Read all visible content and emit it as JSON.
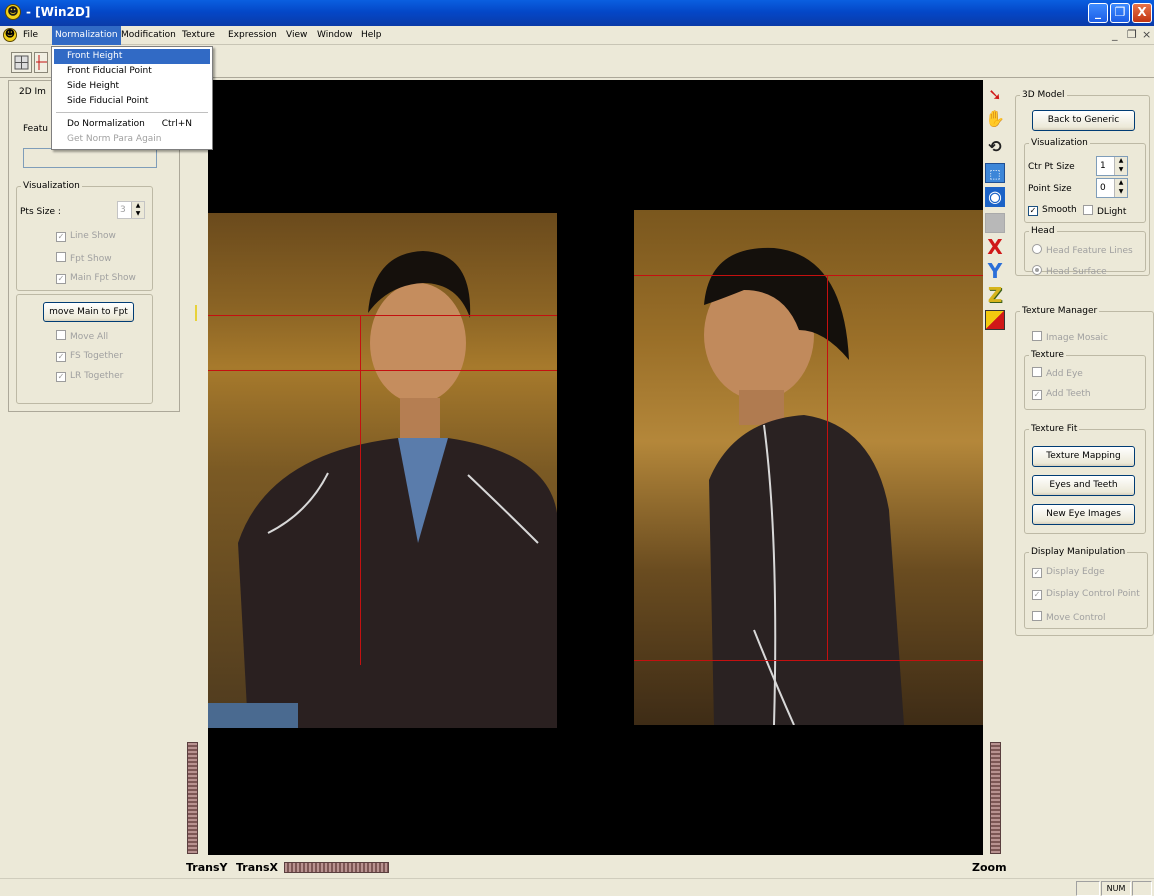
{
  "window": {
    "title": " - [Win2D]",
    "app_icon_glyph": "☻",
    "buttons": {
      "minimize": "_",
      "maximize": "❐",
      "close": "X"
    }
  },
  "menubar": {
    "items": [
      "File",
      "Normalization",
      "Modification",
      "Texture",
      "Expression",
      "View",
      "Window",
      "Help"
    ],
    "active": "Normalization",
    "mdi_buttons": {
      "minimize": "_",
      "restore": "❐",
      "close": "×"
    }
  },
  "normalization_menu": {
    "items": [
      {
        "label": "Front Height",
        "shortcut": "",
        "highlighted": true,
        "disabled": false
      },
      {
        "label": "Front Fiducial Point",
        "shortcut": "",
        "highlighted": false,
        "disabled": false
      },
      {
        "label": "Side Height",
        "shortcut": "",
        "highlighted": false,
        "disabled": false
      },
      {
        "label": "Side Fiducial Point",
        "shortcut": "",
        "highlighted": false,
        "disabled": false
      },
      {
        "label": "Do Normalization",
        "shortcut": "Ctrl+N",
        "highlighted": false,
        "disabled": false
      },
      {
        "label": "Get Norm Para Again",
        "shortcut": "",
        "highlighted": false,
        "disabled": true
      }
    ]
  },
  "left_panel": {
    "group_title_partial": "2D Im",
    "feature_label_partial": "Featu",
    "visualization": {
      "title": "Visualization",
      "pts_size_label": "Pts Size :",
      "pts_size_value": "3",
      "line_show": "Line Show",
      "fpt_show": "Fpt Show",
      "main_fpt_show": "Main Fpt Show"
    },
    "move_group": {
      "button": "move Main to Fpt",
      "move_all": "Move All",
      "fs_together": "FS Together",
      "lr_together": "LR Together"
    }
  },
  "right_panel": {
    "model_3d": {
      "title": "3D Model",
      "back_button": "Back to Generic",
      "visualization": {
        "title": "Visualization",
        "ctr_pt_size_label": "Ctr Pt Size",
        "ctr_pt_size_value": "1",
        "point_size_label": "Point Size",
        "point_size_value": "0",
        "smooth": "Smooth",
        "dlight": "DLight"
      },
      "head": {
        "title": "Head",
        "feature_lines": "Head Feature Lines",
        "surface": "Head Surface"
      }
    },
    "texture_manager": {
      "title": "Texture Manager",
      "image_mosaic": "Image Mosaic",
      "texture": {
        "title": "Texture",
        "add_eye": "Add Eye",
        "add_teeth": "Add Teeth"
      },
      "texture_fit": {
        "title": "Texture Fit",
        "texture_mapping": "Texture Mapping",
        "eyes_and_teeth": "Eyes and Teeth",
        "new_eye_images": "New Eye Images"
      },
      "display_manipulation": {
        "title": "Display Manipulation",
        "display_edge": "Display Edge",
        "display_control_point": "Display Control Point",
        "move_control": "Move Control"
      }
    }
  },
  "bottom": {
    "trans_y": "TransY",
    "trans_x": "TransX",
    "zoom": "Zoom"
  },
  "statusbar": {
    "num": "NUM"
  },
  "icons": [
    "app-smiley-icon",
    "pointer-icon",
    "hand-icon",
    "rotate-icon",
    "select-icon",
    "eye-icon",
    "blank-tool-icon",
    "x-axis-icon",
    "y-axis-icon",
    "z-axis-icon",
    "palette-icon"
  ],
  "colors": {
    "title_bar": "#0a4ed6",
    "menu_highlight": "#316ac5",
    "guide_line": "#c41010",
    "viewer_bg": "#000000"
  }
}
